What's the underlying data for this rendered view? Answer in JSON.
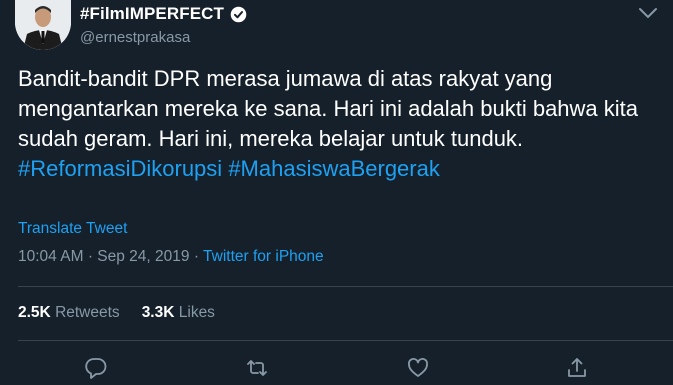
{
  "tweet": {
    "display_name": "#FilmIMPERFECT",
    "handle": "@ernestprakasa",
    "verified": true,
    "text_plain": "Bandit-bandit DPR merasa jumawa di atas rakyat yang mengantarkan mereka ke sana. Hari ini adalah bukti bahwa kita sudah geram. Hari ini, mereka belajar untuk tunduk. ",
    "hashtag_1": "#ReformasiDikorupsi",
    "hashtag_2": "#MahasiswaBergerak",
    "translate_label": "Translate Tweet",
    "time": "10:04 AM",
    "separator": "·",
    "date": "Sep 24, 2019",
    "source": "Twitter for iPhone"
  },
  "stats": {
    "retweets_count": "2.5K",
    "retweets_label": "Retweets",
    "likes_count": "3.3K",
    "likes_label": "Likes"
  },
  "icons": {
    "more": "chevron-down-icon",
    "reply": "reply-icon",
    "retweet": "retweet-icon",
    "like": "heart-icon",
    "share": "share-icon"
  },
  "colors": {
    "background": "#15202b",
    "link": "#1da1f2",
    "secondary_text": "#8899a6",
    "divider": "#38444d"
  }
}
